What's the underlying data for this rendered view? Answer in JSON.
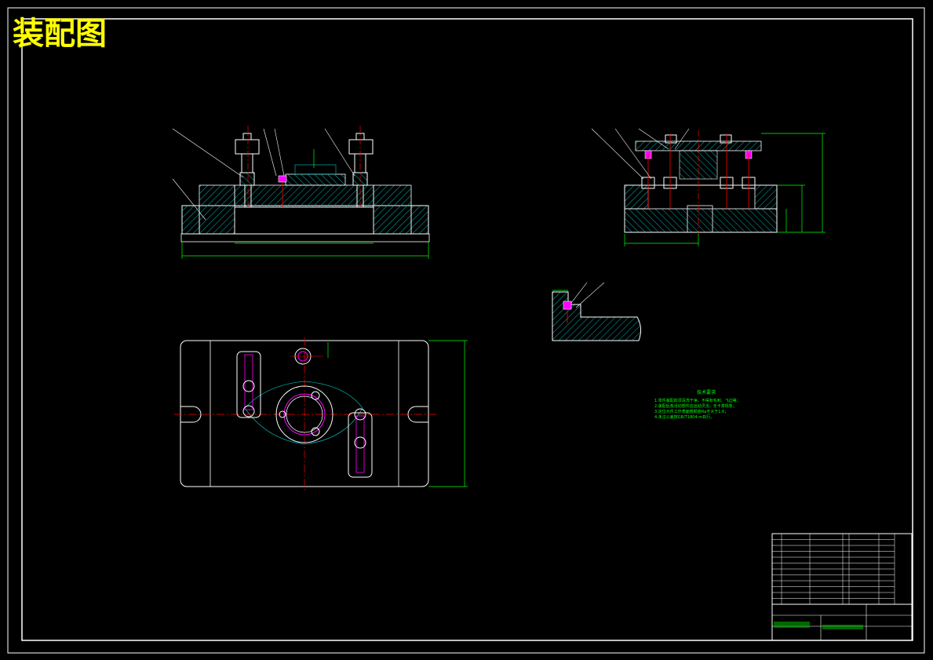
{
  "sheet": {
    "title": "装配图",
    "colors": {
      "background": "#000000",
      "border": "#ffffff",
      "title": "#ffff00",
      "dimension": "#00ff00",
      "centerline": "#ff0000",
      "hatch": "#00c8c8",
      "highlight": "#ff00ff",
      "outline": "#ffffff"
    }
  },
  "views": {
    "front": {
      "name": "front-section-view"
    },
    "side": {
      "name": "side-section-view"
    },
    "plan": {
      "name": "top-plan-view"
    },
    "detail": {
      "name": "detail-section-view"
    }
  },
  "notes": {
    "heading": "技术要求",
    "lines": [
      "1.零件装配前须清洗干净，不得有毛刺、飞边等；",
      "2.装配后各活动部件应运动灵活，无卡滞现象；",
      "3.定位元件工作表面粗糙度Ra不大于1.6；",
      "4.未注公差按GB/T1804-m执行。"
    ]
  },
  "title_block": {
    "icon": "title-block-table"
  }
}
